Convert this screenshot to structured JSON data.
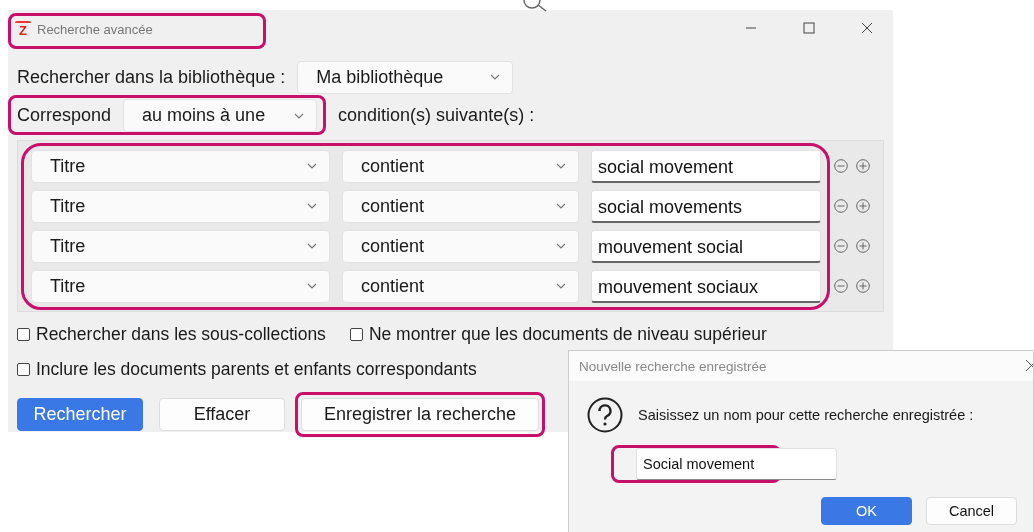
{
  "window": {
    "app_icon_letter": "Z",
    "title": "Recherche avancée",
    "title_highlighted": true
  },
  "library": {
    "label": "Rechercher dans la bibliothèque :",
    "value": "Ma bibliothèque"
  },
  "match": {
    "label": "Correspond",
    "value": "au moins à une",
    "suffix": "condition(s) suivante(s) :",
    "highlighted": true
  },
  "conditions": {
    "highlighted": true,
    "rows": [
      {
        "field": "Titre",
        "operator": "contient",
        "value": "social movement"
      },
      {
        "field": "Titre",
        "operator": "contient",
        "value": "social movements"
      },
      {
        "field": "Titre",
        "operator": "contient",
        "value": "mouvement social"
      },
      {
        "field": "Titre",
        "operator": "contient",
        "value": "mouvement sociaux"
      }
    ]
  },
  "options": [
    {
      "label": "Rechercher dans les sous-collections",
      "checked": false
    },
    {
      "label": "Ne montrer que les documents de niveau supérieur",
      "checked": false
    },
    {
      "label": "Inclure les documents parents et enfants correspondants",
      "checked": false
    }
  ],
  "buttons": [
    {
      "label": "Rechercher",
      "kind": "primary",
      "highlighted": false
    },
    {
      "label": "Effacer",
      "kind": "default",
      "highlighted": false
    },
    {
      "label": "Enregistrer la recherche",
      "kind": "default",
      "highlighted": true
    }
  ],
  "save_dialog": {
    "title": "Nouvelle recherche enregistrée",
    "prompt": "Saisissez un nom pour cette recherche enregistrée :",
    "value": "Social movement",
    "value_highlighted": true,
    "buttons": [
      {
        "label": "OK",
        "kind": "primary"
      },
      {
        "label": "Cancel",
        "kind": "default"
      }
    ]
  }
}
